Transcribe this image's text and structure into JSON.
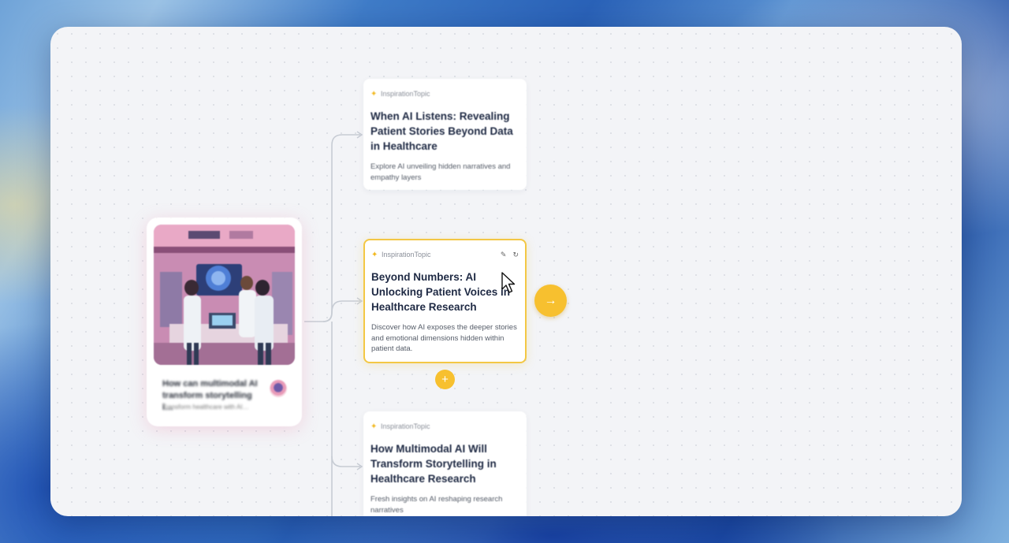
{
  "source": {
    "title": "How can multimodal AI transform storytelling i…",
    "subtitle": "Transform healthcare with AI…"
  },
  "topics": [
    {
      "tag": "InspirationTopic",
      "title": "When AI Listens: Revealing Patient Stories Beyond Data in Healthcare",
      "description": "Explore AI unveiling hidden narratives and empathy layers"
    },
    {
      "tag": "InspirationTopic",
      "title": "Beyond Numbers: AI Unlocking Patient Voices in Healthcare Research",
      "description": "Discover how AI exposes the deeper stories and emotional dimensions hidden within patient data."
    },
    {
      "tag": "InspirationTopic",
      "title": "How Multimodal AI Will Transform Storytelling in Healthcare Research",
      "description": "Fresh insights on AI reshaping research narratives"
    }
  ],
  "actions": {
    "edit_icon": "✎",
    "refresh_icon": "↻",
    "next_icon": "→",
    "add_icon": "+"
  },
  "colors": {
    "accent": "#f7c02f",
    "active_border": "#f3c744",
    "title_text": "#1f2a44"
  }
}
